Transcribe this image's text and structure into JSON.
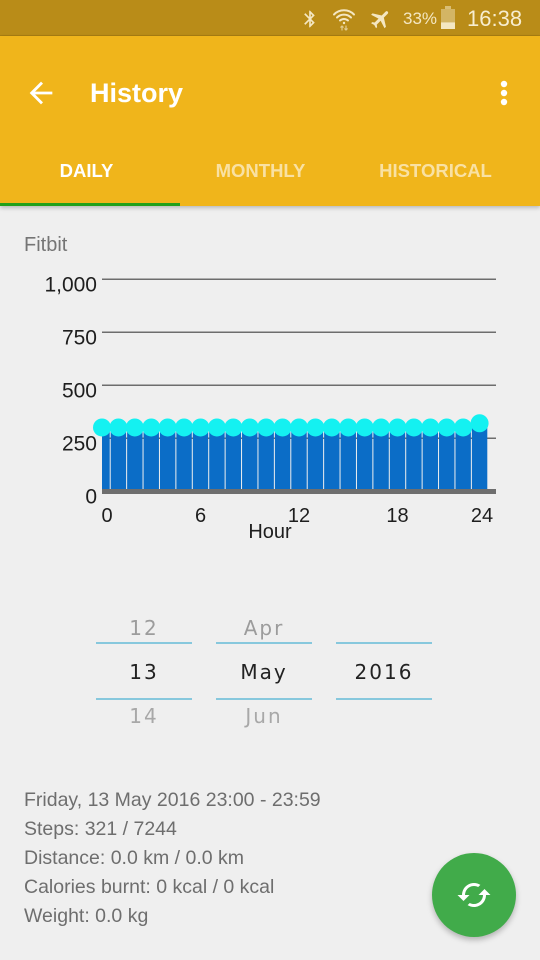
{
  "status_bar": {
    "icons": [
      "bluetooth-icon",
      "wifi-icon",
      "airplane-mode-icon",
      "battery-icon"
    ],
    "battery_percent": "33%",
    "battery_level": 0.33,
    "time": "16:38"
  },
  "toolbar": {
    "title": "History",
    "back_icon": "arrow-back-icon",
    "menu_icon": "more-vert-icon"
  },
  "tabs": [
    {
      "label": "DAILY",
      "active": true
    },
    {
      "label": "MONTHLY",
      "active": false
    },
    {
      "label": "HISTORICAL",
      "active": false
    }
  ],
  "colors": {
    "status_bar": "#B98C18",
    "app_bar": "#F0B51B",
    "tab_indicator": "#22A01A",
    "picker_divider": "#87C8DD",
    "fab": "#41AB4A"
  },
  "chart_data": {
    "type": "bar",
    "title": "Fitbit",
    "xlabel": "Hour",
    "ylabel": "",
    "x": [
      0,
      1,
      2,
      3,
      4,
      5,
      6,
      7,
      8,
      9,
      10,
      11,
      12,
      13,
      14,
      15,
      16,
      17,
      18,
      19,
      20,
      21,
      22,
      23
    ],
    "values": [
      301,
      301,
      301,
      301,
      301,
      301,
      301,
      301,
      301,
      301,
      301,
      301,
      301,
      301,
      301,
      301,
      301,
      301,
      301,
      301,
      301,
      301,
      301,
      321
    ],
    "markers": "circle",
    "xlim": [
      0,
      24
    ],
    "ylim": [
      0,
      1000
    ],
    "xticks": [
      0,
      6,
      12,
      18,
      24
    ],
    "xtick_labels": [
      "0",
      "6",
      "12",
      "18",
      "24"
    ],
    "yticks": [
      0,
      250,
      500,
      750,
      1000
    ],
    "ytick_labels": [
      "0",
      "250",
      "500",
      "750",
      "1,000"
    ],
    "grid": true,
    "legend": "none",
    "colors": {
      "bar": "#0B6DC7",
      "marker": "#14F1F1",
      "grid": "#6D6D6D",
      "axis": "#6E6E6E"
    }
  },
  "date_picker": {
    "day": {
      "prev": "12",
      "current": "13",
      "next": "14"
    },
    "month": {
      "prev": "Apr",
      "current": "May",
      "next": "Jun"
    },
    "year": {
      "prev": "",
      "current": "2016",
      "next": ""
    }
  },
  "details": {
    "lines": [
      "Friday, 13 May 2016 23:00 - 23:59",
      "Steps: 321 / 7244",
      "Distance: 0.0 km / 0.0 km",
      "Calories burnt: 0 kcal / 0 kcal",
      "Weight: 0.0 kg"
    ]
  },
  "fab": {
    "icon": "sync-icon"
  }
}
